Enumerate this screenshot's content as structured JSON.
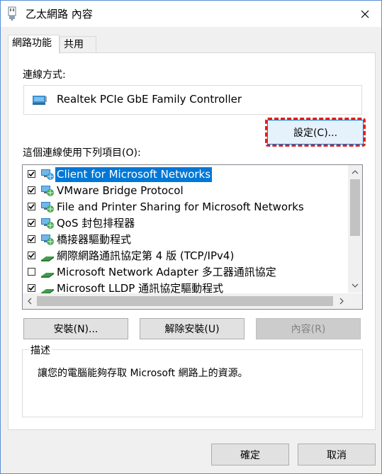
{
  "window": {
    "title": "乙太網路 內容"
  },
  "tabs": [
    {
      "label": "網路功能"
    },
    {
      "label": "共用"
    }
  ],
  "connection": {
    "label": "連線方式:",
    "adapter": "Realtek PCIe GbE Family Controller",
    "configure_button": "設定(C)..."
  },
  "items_label": "這個連線使用下列項目(O):",
  "items": [
    {
      "label": "Client for Microsoft Networks",
      "checked": true,
      "selected": true,
      "icon": "network-client-icon"
    },
    {
      "label": "VMware Bridge Protocol",
      "checked": true,
      "selected": false,
      "icon": "network-service-icon"
    },
    {
      "label": "File and Printer Sharing for Microsoft Networks",
      "checked": true,
      "selected": false,
      "icon": "network-service-icon"
    },
    {
      "label": "QoS 封包排程器",
      "checked": true,
      "selected": false,
      "icon": "network-service-icon"
    },
    {
      "label": "橋接器驅動程式",
      "checked": true,
      "selected": false,
      "icon": "network-service-icon"
    },
    {
      "label": "網際網路通訊協定第 4 版 (TCP/IPv4)",
      "checked": true,
      "selected": false,
      "icon": "protocol-icon"
    },
    {
      "label": "Microsoft Network Adapter 多工器通訊協定",
      "checked": false,
      "selected": false,
      "icon": "protocol-icon"
    },
    {
      "label": "Microsoft LLDP 通訊協定驅動程式",
      "checked": true,
      "selected": false,
      "icon": "protocol-icon"
    }
  ],
  "buttons": {
    "install": "安裝(N)...",
    "uninstall": "解除安裝(U)",
    "properties": "內容(R)",
    "ok": "確定",
    "cancel": "取消"
  },
  "description": {
    "legend": "描述",
    "text": "讓您的電腦能夠存取 Microsoft 網路上的資源。"
  },
  "colors": {
    "selection": "#0078d7",
    "highlight_ring": "#e0201c",
    "window_border": "#5b8fd6"
  }
}
